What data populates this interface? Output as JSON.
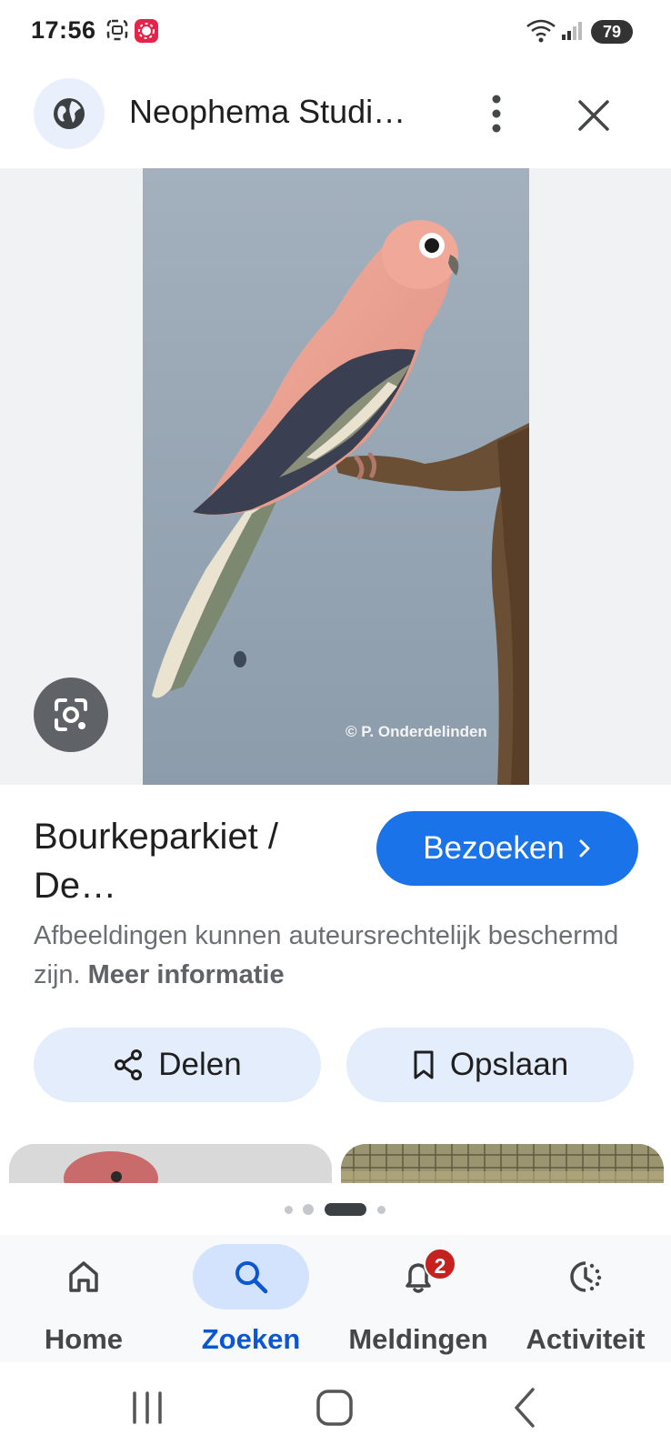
{
  "status_bar": {
    "time": "17:56",
    "battery": "79",
    "icons": [
      "screenshot-icon",
      "app-notification-icon",
      "wifi-icon",
      "signal-icon",
      "battery-icon"
    ]
  },
  "top_bar": {
    "site_title": "Neophema Studi…",
    "site_icon": "globe-icon",
    "menu_icon": "more-vert-icon",
    "close_icon": "close-icon"
  },
  "image": {
    "watermark": "© P. Onderdelinden",
    "lens_icon": "google-lens-icon"
  },
  "result": {
    "title": "Bourkeparkiet / De…",
    "visit_label": "Bezoeken",
    "copyright_text": "Afbeeldingen kunnen auteursrechtelijk beschermd zijn.",
    "more_info_label": "Meer informatie"
  },
  "actions": {
    "share_label": "Delen",
    "save_label": "Opslaan"
  },
  "pager": {
    "count": 4,
    "active_index": 2
  },
  "bottom_nav": {
    "items": [
      {
        "label": "Home",
        "icon": "home-icon",
        "active": false
      },
      {
        "label": "Zoeken",
        "icon": "search-icon",
        "active": true
      },
      {
        "label": "Meldingen",
        "icon": "bell-icon",
        "active": false,
        "badge": "2"
      },
      {
        "label": "Activiteit",
        "icon": "activity-icon",
        "active": false
      }
    ]
  },
  "colors": {
    "accent": "#1a73e8",
    "accent_light": "#e3edfb",
    "active_nav": "#0b57d0",
    "badge": "#c5221f"
  }
}
